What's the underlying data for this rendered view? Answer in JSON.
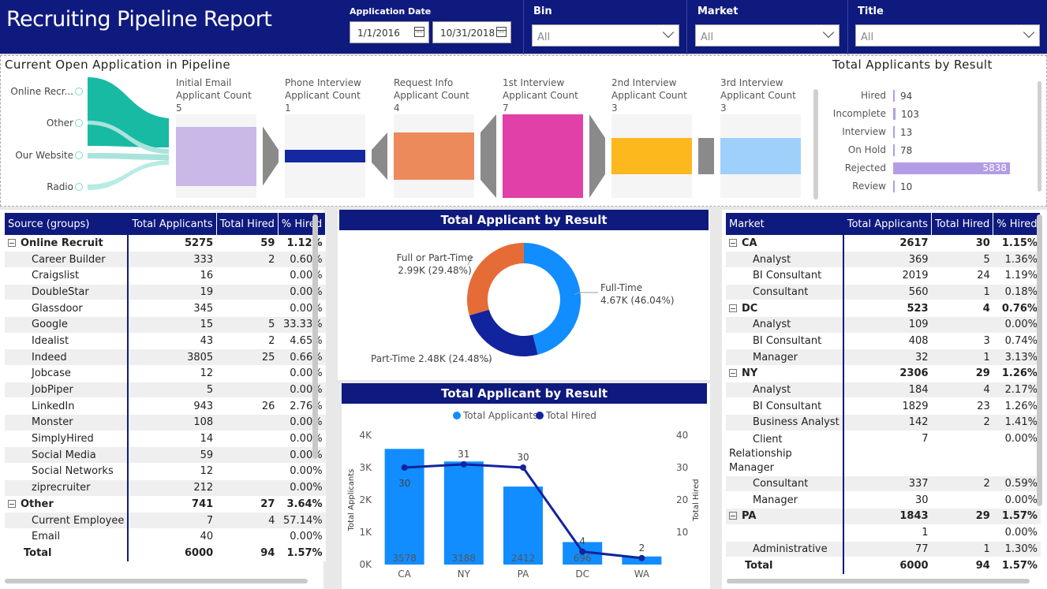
{
  "header": {
    "title": "Recruiting Pipeline Report",
    "app_date_label": "Application Date",
    "date_from": "1/1/2016",
    "date_to": "10/31/2018",
    "bin_label": "Bin",
    "bin_value": "All",
    "market_label": "Market",
    "market_value": "All",
    "title_label": "Title",
    "title_value": "All"
  },
  "pipeline": {
    "title": "Current Open Application in Pipeline",
    "sources": [
      "Online Recr...",
      "Other",
      "Our Website",
      "Radio"
    ],
    "stages": [
      {
        "name": "Initial Email",
        "metric": "Applicant Count",
        "count": "5",
        "color": "#c9b8e8",
        "fill": 0.71
      },
      {
        "name": "Phone Interview",
        "metric": "Applicant Count",
        "count": "1",
        "color": "#1428a0",
        "fill": 0.14
      },
      {
        "name": "Request Info",
        "metric": "Applicant Count",
        "count": "4",
        "color": "#ec8a5c",
        "fill": 0.57
      },
      {
        "name": "1st Interview",
        "metric": "Applicant Count",
        "count": "7",
        "color": "#e040a8",
        "fill": 1.0
      },
      {
        "name": "2nd Interview",
        "metric": "Applicant Count",
        "count": "3",
        "color": "#fdb81e",
        "fill": 0.43
      },
      {
        "name": "3rd Interview",
        "metric": "Applicant Count",
        "count": "3",
        "color": "#9fd0fb",
        "fill": 0.43
      }
    ]
  },
  "by_result": {
    "title": "Total Applicants by Result",
    "rows": [
      {
        "label": "Hired",
        "value": "94",
        "num": 94
      },
      {
        "label": "Incomplete",
        "value": "103",
        "num": 103
      },
      {
        "label": "Interview",
        "value": "13",
        "num": 13
      },
      {
        "label": "On Hold",
        "value": "78",
        "num": 78
      },
      {
        "label": "Rejected",
        "value": "5838",
        "num": 5838
      },
      {
        "label": "Review",
        "value": "10",
        "num": 10
      }
    ],
    "bar_color": "#b39ce6"
  },
  "source_table": {
    "headers": [
      "Source (groups)",
      "Total Applicants",
      "Total Hired",
      "% Hired"
    ],
    "rows": [
      {
        "name": "Online Recruit",
        "apps": "5275",
        "hired": "59",
        "pct": "1.12%",
        "group": true
      },
      {
        "name": "Career Builder",
        "apps": "333",
        "hired": "2",
        "pct": "0.60%"
      },
      {
        "name": "Craigslist",
        "apps": "16",
        "hired": "",
        "pct": "0.00%"
      },
      {
        "name": "DoubleStar",
        "apps": "19",
        "hired": "",
        "pct": "0.00%"
      },
      {
        "name": "Glassdoor",
        "apps": "345",
        "hired": "",
        "pct": "0.00%"
      },
      {
        "name": "Google",
        "apps": "15",
        "hired": "5",
        "pct": "33.33%"
      },
      {
        "name": "Idealist",
        "apps": "43",
        "hired": "2",
        "pct": "4.65%"
      },
      {
        "name": "Indeed",
        "apps": "3805",
        "hired": "25",
        "pct": "0.66%"
      },
      {
        "name": "Jobcase",
        "apps": "12",
        "hired": "",
        "pct": "0.00%"
      },
      {
        "name": "JobPiper",
        "apps": "5",
        "hired": "",
        "pct": "0.00%"
      },
      {
        "name": "LinkedIn",
        "apps": "943",
        "hired": "26",
        "pct": "2.76%"
      },
      {
        "name": "Monster",
        "apps": "108",
        "hired": "",
        "pct": "0.00%"
      },
      {
        "name": "SimplyHired",
        "apps": "14",
        "hired": "",
        "pct": "0.00%"
      },
      {
        "name": "Social Media",
        "apps": "59",
        "hired": "",
        "pct": "0.00%"
      },
      {
        "name": "Social Networks",
        "apps": "12",
        "hired": "",
        "pct": "0.00%"
      },
      {
        "name": "ziprecruiter",
        "apps": "212",
        "hired": "",
        "pct": "0.00%"
      },
      {
        "name": "Other",
        "apps": "741",
        "hired": "27",
        "pct": "3.64%",
        "group": true
      },
      {
        "name": "Current Employee",
        "apps": "7",
        "hired": "4",
        "pct": "57.14%"
      },
      {
        "name": "Email",
        "apps": "40",
        "hired": "",
        "pct": "0.00%"
      }
    ],
    "total": {
      "name": "Total",
      "apps": "6000",
      "hired": "94",
      "pct": "1.57%"
    }
  },
  "market_table": {
    "headers": [
      "Market",
      "Total Applicants",
      "Total Hired",
      "% Hired"
    ],
    "rows": [
      {
        "name": "CA",
        "apps": "2617",
        "hired": "30",
        "pct": "1.15%",
        "group": true
      },
      {
        "name": "Analyst",
        "apps": "369",
        "hired": "5",
        "pct": "1.36%"
      },
      {
        "name": "BI Consultant",
        "apps": "2019",
        "hired": "24",
        "pct": "1.19%"
      },
      {
        "name": "Consultant",
        "apps": "560",
        "hired": "1",
        "pct": "0.18%"
      },
      {
        "name": "DC",
        "apps": "523",
        "hired": "4",
        "pct": "0.76%",
        "group": true
      },
      {
        "name": "Analyst",
        "apps": "109",
        "hired": "",
        "pct": "0.00%"
      },
      {
        "name": "BI Consultant",
        "apps": "408",
        "hired": "3",
        "pct": "0.74%"
      },
      {
        "name": "Manager",
        "apps": "32",
        "hired": "1",
        "pct": "3.13%"
      },
      {
        "name": "NY",
        "apps": "2306",
        "hired": "29",
        "pct": "1.26%",
        "group": true
      },
      {
        "name": "Analyst",
        "apps": "184",
        "hired": "4",
        "pct": "2.17%"
      },
      {
        "name": "BI Consultant",
        "apps": "1829",
        "hired": "23",
        "pct": "1.26%"
      },
      {
        "name": "Business Analyst",
        "apps": "142",
        "hired": "2",
        "pct": "1.41%"
      },
      {
        "name": "Client Relationship Manager",
        "apps": "7",
        "hired": "",
        "pct": "0.00%"
      },
      {
        "name": "Consultant",
        "apps": "337",
        "hired": "2",
        "pct": "0.59%"
      },
      {
        "name": "Manager",
        "apps": "30",
        "hired": "",
        "pct": "0.00%"
      },
      {
        "name": "PA",
        "apps": "1843",
        "hired": "29",
        "pct": "1.57%",
        "group": true
      },
      {
        "name": "",
        "apps": "1",
        "hired": "",
        "pct": "0.00%"
      },
      {
        "name": "Administrative",
        "apps": "77",
        "hired": "1",
        "pct": "1.30%"
      }
    ],
    "total": {
      "name": "Total",
      "apps": "6000",
      "hired": "94",
      "pct": "1.57%"
    }
  },
  "chart_data": [
    {
      "type": "pie",
      "title": "Total Applicant by Result",
      "donut": true,
      "categories": [
        "Full-Time",
        "Part-Time",
        "Full or Part-Time"
      ],
      "values": [
        4.67,
        2.48,
        2.99
      ],
      "labels": [
        "Full-Time\n4.67K (46.04%)",
        "Part-Time 2.48K (24.48%)",
        "Full or Part-Time\n2.99K (29.48%)"
      ],
      "colors": [
        "#118dff",
        "#12239e",
        "#e66c37"
      ]
    },
    {
      "type": "bar",
      "title": "Total Applicant by Result",
      "categories": [
        "CA",
        "NY",
        "PA",
        "DC",
        "WA"
      ],
      "series": [
        {
          "name": "Total Applicants",
          "type": "bar",
          "values": [
            3578,
            3188,
            2412,
            696,
            250
          ],
          "labels": [
            "3578",
            "3188",
            "2412",
            "696",
            ""
          ],
          "color": "#118dff"
        },
        {
          "name": "Total Hired",
          "type": "line",
          "values": [
            30,
            31,
            30,
            4,
            2
          ],
          "labels": [
            "30",
            "31",
            "30",
            "4",
            "2"
          ],
          "color": "#12239e"
        }
      ],
      "ylabel": "Total Applicants",
      "y2label": "Total Hired",
      "ylim": [
        0,
        4000
      ],
      "y2lim": [
        0,
        40
      ],
      "yticks": [
        "0K",
        "1K",
        "2K",
        "3K",
        "4K"
      ],
      "y2ticks": [
        "10",
        "20",
        "30",
        "40"
      ],
      "legend": "top"
    }
  ]
}
